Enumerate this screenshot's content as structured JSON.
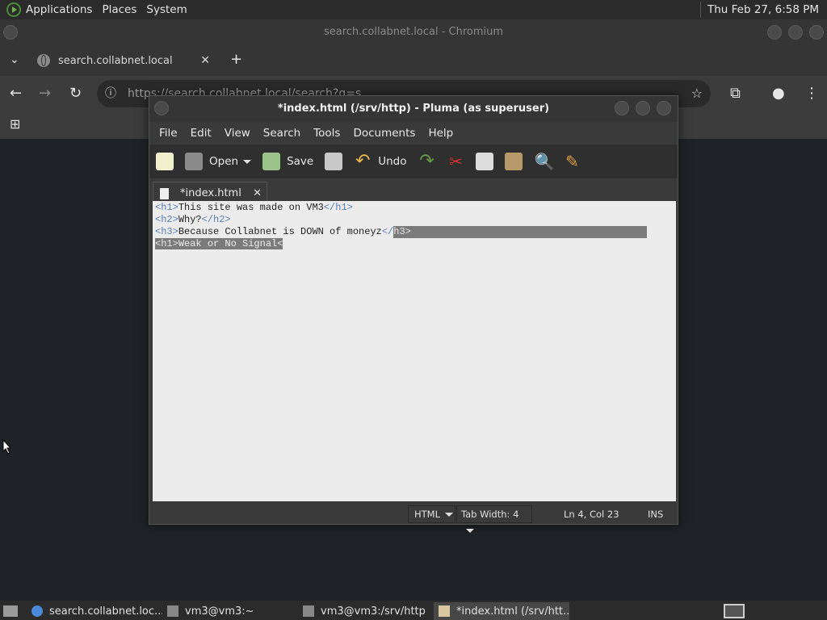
{
  "top_panel": {
    "menus": [
      "Applications",
      "Places",
      "System"
    ],
    "clock": "Thu Feb 27,  6:58 PM"
  },
  "chromium": {
    "window_title": "search.collabnet.local - Chromium",
    "tab_title": "search.collabnet.local",
    "url": "https://search.collabnet.local/search?q=s"
  },
  "pluma": {
    "window_title": "*index.html (/srv/http) - Pluma (as superuser)",
    "menu": [
      "File",
      "Edit",
      "View",
      "Search",
      "Tools",
      "Documents",
      "Help"
    ],
    "toolbar": {
      "open_label": "Open",
      "save_label": "Save",
      "undo_label": "Undo"
    },
    "doc_tab": "*index.html",
    "editor_lines": [
      {
        "open": "<h1>",
        "text": "This site was made on VM3",
        "close": "</h1>"
      },
      {
        "open": "<h2>",
        "text": "Why?",
        "close": "</h2>"
      },
      {
        "open": "<h3>",
        "text": "Because Collabnet is DOWN of moneyz",
        "close": "</",
        "close_sel": "h3>"
      },
      {
        "open": "<h1>",
        "text": "Weak or No Signal<",
        "close": ""
      }
    ],
    "status": {
      "language": "HTML",
      "tab_width": "Tab Width:  4",
      "position": "Ln 4, Col 23",
      "mode": "INS"
    }
  },
  "taskbar": {
    "items": [
      "search.collabnet.loc...",
      "vm3@vm3:~",
      "vm3@vm3:/srv/http",
      "*index.html (/srv/htt..."
    ]
  },
  "colors": {
    "panel": "#2b2b2b",
    "editor_bg": "#ececec",
    "tag": "#5b7fb8",
    "selection": "#7b7b7b"
  }
}
